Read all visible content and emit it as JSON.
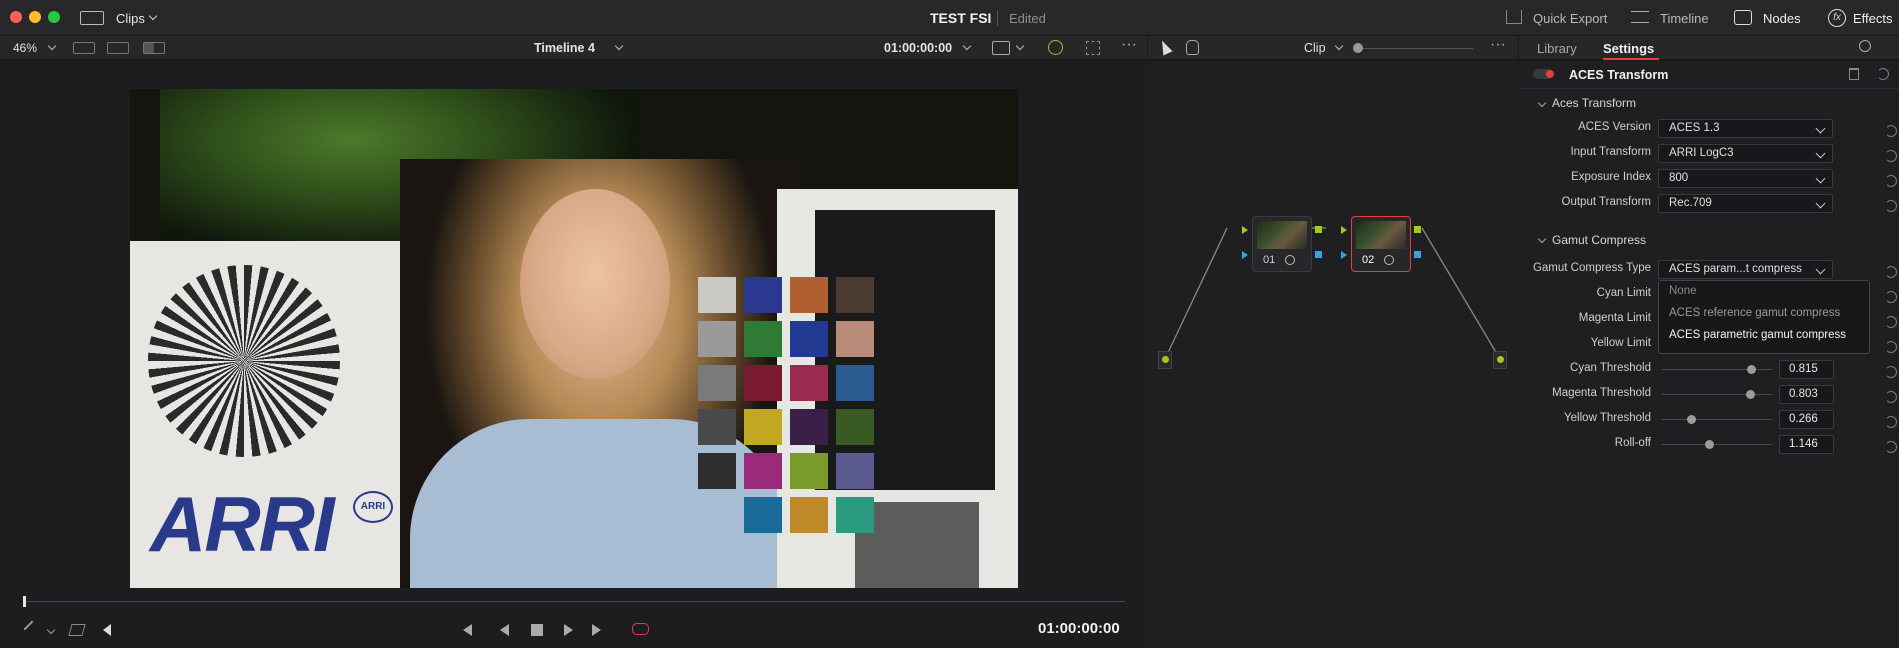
{
  "window": {
    "project_title": "TEST FSI",
    "edit_status": "Edited",
    "clips_label": "Clips"
  },
  "top_nav": {
    "quick_export": "Quick Export",
    "timeline": "Timeline",
    "nodes": "Nodes",
    "effects": "Effects"
  },
  "viewer_toolbar": {
    "zoom": "46%",
    "timeline_name": "Timeline 4",
    "timecode": "01:00:00:00"
  },
  "node_toolbar": {
    "mode": "Clip"
  },
  "inspector": {
    "tabs": [
      "Library",
      "Settings"
    ],
    "active_tab": "Settings",
    "effect_name": "ACES Transform",
    "sections": {
      "aces": "Aces Transform",
      "gamut": "Gamut Compress"
    },
    "aces_rows": [
      {
        "label": "ACES Version",
        "value": "ACES 1.3"
      },
      {
        "label": "Input Transform",
        "value": "ARRI LogC3"
      },
      {
        "label": "Exposure Index",
        "value": "800"
      },
      {
        "label": "Output Transform",
        "value": "Rec.709"
      }
    ],
    "gamut_type": {
      "label": "Gamut Compress Type",
      "value": "ACES param...t compress"
    },
    "gamut_hidden_rows": [
      "Cyan Limit",
      "Magenta Limit",
      "Yellow Limit"
    ],
    "dropdown_options": [
      "None",
      "ACES reference gamut compress",
      "ACES parametric gamut compress"
    ],
    "dropdown_selected": "ACES parametric gamut compress",
    "sliders": [
      {
        "label": "Cyan Threshold",
        "value": "0.815",
        "fraction": 0.815
      },
      {
        "label": "Magenta Threshold",
        "value": "0.803",
        "fraction": 0.803
      },
      {
        "label": "Yellow Threshold",
        "value": "0.266",
        "fraction": 0.266
      },
      {
        "label": "Roll-off",
        "value": "1.146",
        "fraction": 0.43
      }
    ]
  },
  "nodes": [
    {
      "label": "01"
    },
    {
      "label": "02"
    }
  ],
  "viewer": {
    "logo_text": "ARRI",
    "logo_badge": "ARRI",
    "transport_timecode": "01:00:00:00"
  },
  "colors": {
    "accent": "#e0413b",
    "node_green": "#9ccc1e",
    "node_blue": "#2ea7e0",
    "bg": "#1b1b1e"
  }
}
